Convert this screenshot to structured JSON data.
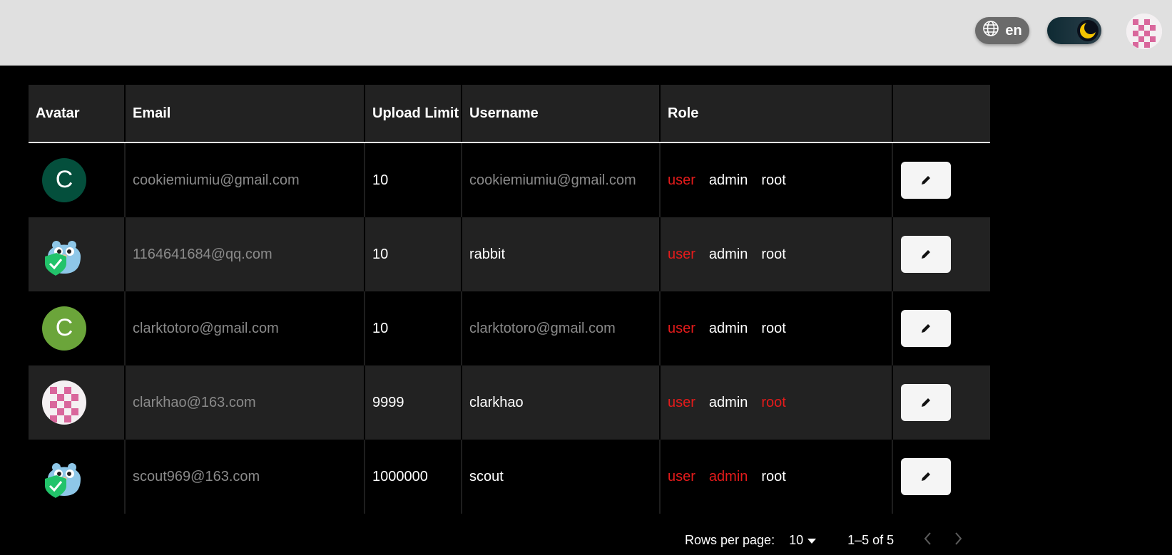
{
  "topbar": {
    "language": "en",
    "theme": "dark",
    "icons": {
      "language": "globe-icon",
      "theme": "moon-icon",
      "avatar": "checker-avatar"
    }
  },
  "table": {
    "columns": [
      "Avatar",
      "Email",
      "Upload Limit",
      "Username",
      "Role",
      ""
    ],
    "roles": [
      "user",
      "admin",
      "root"
    ],
    "rows": [
      {
        "avatar_type": "letter",
        "avatar_letter": "C",
        "avatar_color": "#044f3c",
        "email": "cookiemiumiu@gmail.com",
        "upload_limit": "10",
        "username": "cookiemiumiu@gmail.com",
        "active_roles": [
          "user"
        ]
      },
      {
        "avatar_type": "gopher",
        "email": "1164641684@qq.com",
        "upload_limit": "10",
        "username": "rabbit",
        "active_roles": [
          "user"
        ]
      },
      {
        "avatar_type": "letter",
        "avatar_letter": "C",
        "avatar_color": "#6ba53a",
        "email": "clarktotoro@gmail.com",
        "upload_limit": "10",
        "username": "clarktotoro@gmail.com",
        "active_roles": [
          "user"
        ]
      },
      {
        "avatar_type": "checker",
        "email": "clarkhao@163.com",
        "upload_limit": "9999",
        "username": "clarkhao",
        "active_roles": [
          "user",
          "root"
        ]
      },
      {
        "avatar_type": "gopher",
        "email": "scout969@163.com",
        "upload_limit": "1000000",
        "username": "scout",
        "active_roles": [
          "user",
          "admin"
        ]
      }
    ]
  },
  "pagination": {
    "rows_per_page_label": "Rows per page:",
    "rows_per_page_value": "10",
    "range_text": "1–5 of 5"
  },
  "colors": {
    "active_role": "#e41b1b",
    "header_bg": "#222222",
    "topbar_bg": "#e0e0e0"
  }
}
